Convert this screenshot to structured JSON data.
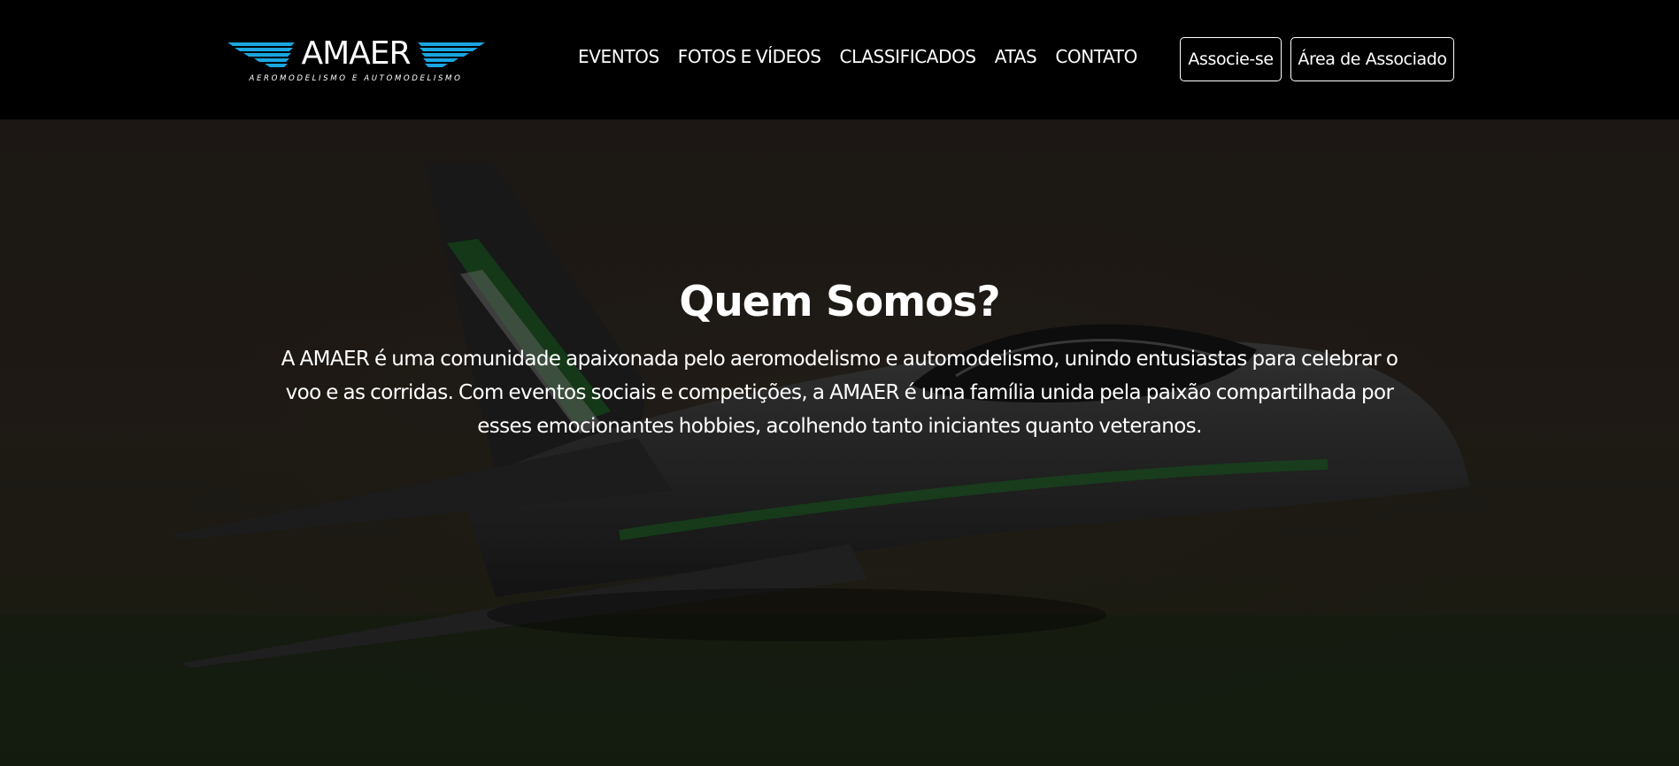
{
  "brand": {
    "name": "AMAER",
    "tagline": "AEROMODELISMO E AUTOMODELISMO",
    "accent_color": "#1aa7e0"
  },
  "nav": {
    "items": [
      {
        "label": "EVENTOS"
      },
      {
        "label": "FOTOS E VÍDEOS"
      },
      {
        "label": "CLASSIFICADOS"
      },
      {
        "label": "ATAS"
      },
      {
        "label": "CONTATO"
      }
    ]
  },
  "actions": {
    "join_label": "Associe-se",
    "member_area_label": "Área de Associado"
  },
  "hero": {
    "title": "Quem Somos?",
    "text": "A AMAER é uma comunidade apaixonada pelo aeromodelismo e automodelismo, unindo entusiastas para celebrar o voo e as corridas. Com eventos sociais e competições, a AMAER é uma família unida pela paixão compartilhada por esses emocionantes hobbies, acolhendo tanto iniciantes quanto veteranos.",
    "background_image": "rc-jet-plane-icon"
  }
}
